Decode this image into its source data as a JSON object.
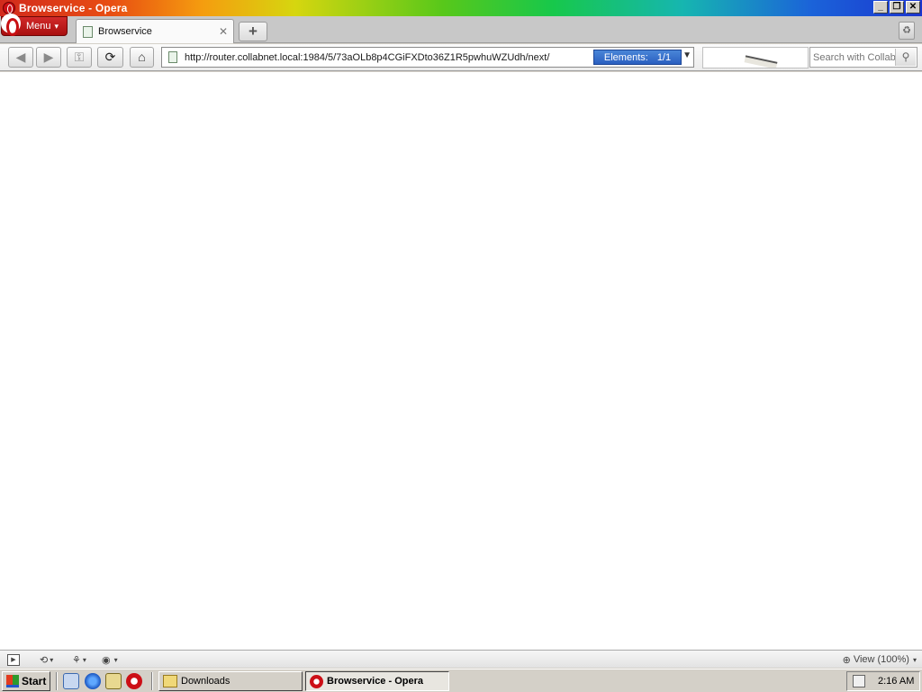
{
  "window": {
    "title": "Browservice - Opera",
    "buttons": {
      "minimize": "_",
      "restore": "❐",
      "close": "✕"
    }
  },
  "tabstrip": {
    "menu_label": "Menu",
    "tabs": [
      {
        "label": "Browservice"
      }
    ],
    "new_tab_symbol": "+",
    "trash_symbol": "♻"
  },
  "navbar": {
    "url": "http://router.collabnet.local:1984/5/73aOLb8p4CGiFXDto36Z1R5pwhuWZUdh/next/",
    "elements_label": "Elements:",
    "elements_count": "1/1",
    "search_placeholder": "Search with Collab",
    "icons": [
      "back-arrow-icon",
      "forward-arrow-icon",
      "key-icon",
      "reload-icon",
      "home-icon",
      "search-icon"
    ]
  },
  "statusbar": {
    "zoom_label": "View (100%)"
  },
  "taskbar": {
    "start_label": "Start",
    "tasks": [
      {
        "label": "Downloads"
      },
      {
        "label": "Browservice - Opera"
      }
    ],
    "clock": "2:16 AM"
  },
  "colors": {
    "opera_red": "#cc0f16",
    "elements_badge": "#2f65c4"
  }
}
